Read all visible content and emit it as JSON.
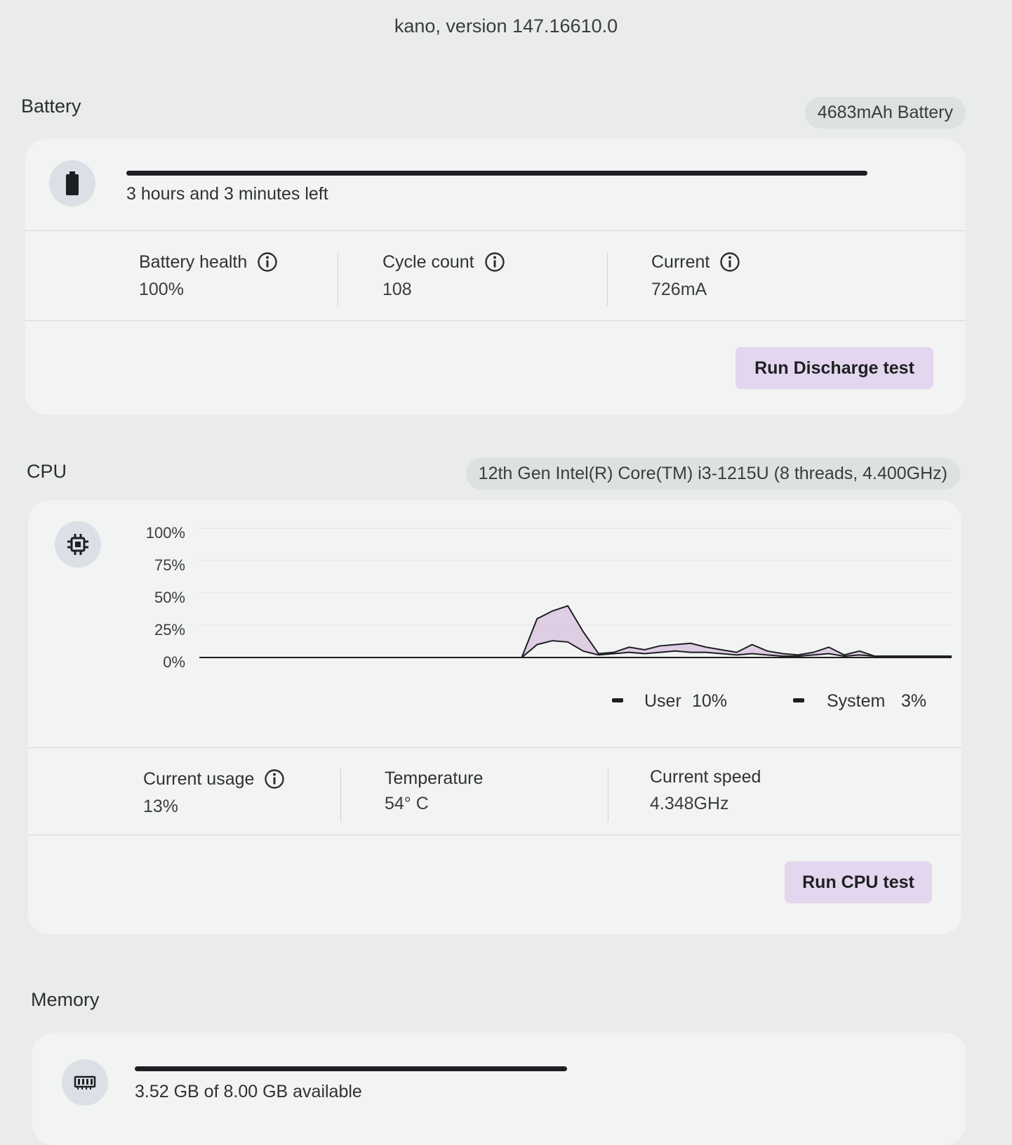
{
  "app": {
    "version_text": "kano, version 147.16610.0"
  },
  "battery": {
    "title": "Battery",
    "badge": "4683mAh Battery",
    "icon": "battery-icon",
    "level_fraction": 1.0,
    "time_left": "3 hours and 3 minutes left",
    "stats": [
      {
        "label": "Battery health",
        "value": "100%"
      },
      {
        "label": "Cycle count",
        "value": "108"
      },
      {
        "label": "Current",
        "value": "726mA"
      }
    ],
    "button_label": "Run Discharge test"
  },
  "cpu": {
    "title": "CPU",
    "badge": "12th Gen Intel(R) Core(TM) i3-1215U (8 threads, 4.400GHz)",
    "icon": "cpu-chip-icon",
    "legend": [
      {
        "name": "User",
        "value": "10%"
      },
      {
        "name": "System",
        "value": "3%"
      }
    ],
    "stats": [
      {
        "label": "Current usage",
        "value": "13%"
      },
      {
        "label": "Temperature",
        "value": "54° C"
      },
      {
        "label": "Current speed",
        "value": "4.348GHz"
      }
    ],
    "button_label": "Run CPU test"
  },
  "memory": {
    "title": "Memory",
    "icon": "memory-icon",
    "available_fraction": 0.44,
    "text": "3.52 GB of 8.00 GB available"
  },
  "colors": {
    "accent": "#e3d6ee",
    "fill": "#d9c3e0",
    "line": "#1d1f22"
  },
  "chart_data": {
    "type": "line",
    "title": "",
    "ylim": [
      0,
      100
    ],
    "ytick_labels": [
      "100%",
      "75%",
      "50%",
      "25%",
      "0%"
    ],
    "grid": true,
    "legend_placement": "bottom-right",
    "x": [
      0,
      1,
      2,
      3,
      4,
      5,
      6,
      7,
      8,
      9,
      10,
      11,
      12,
      13,
      14,
      15,
      16,
      17,
      18,
      19,
      20,
      21,
      22,
      23,
      24,
      25,
      26,
      27,
      28,
      29,
      30,
      31,
      32,
      33,
      34,
      35,
      36,
      37,
      38,
      39,
      40,
      41,
      42,
      43,
      44,
      45,
      46,
      47,
      48,
      49
    ],
    "series": [
      {
        "name": "User",
        "values": [
          0,
          0,
          0,
          0,
          0,
          0,
          0,
          0,
          0,
          0,
          0,
          0,
          0,
          0,
          0,
          0,
          0,
          0,
          0,
          0,
          0,
          0,
          30,
          36,
          40,
          20,
          3,
          4,
          8,
          6,
          9,
          10,
          11,
          8,
          6,
          4,
          10,
          5,
          3,
          2,
          4,
          8,
          2,
          5,
          1,
          1,
          1,
          1,
          1,
          1
        ]
      },
      {
        "name": "System",
        "values": [
          0,
          0,
          0,
          0,
          0,
          0,
          0,
          0,
          0,
          0,
          0,
          0,
          0,
          0,
          0,
          0,
          0,
          0,
          0,
          0,
          0,
          0,
          10,
          13,
          12,
          5,
          2,
          3,
          4,
          3,
          4,
          5,
          4,
          4,
          3,
          2,
          3,
          2,
          1,
          1,
          2,
          3,
          1,
          2,
          1,
          1,
          1,
          1,
          1,
          1
        ]
      }
    ]
  }
}
